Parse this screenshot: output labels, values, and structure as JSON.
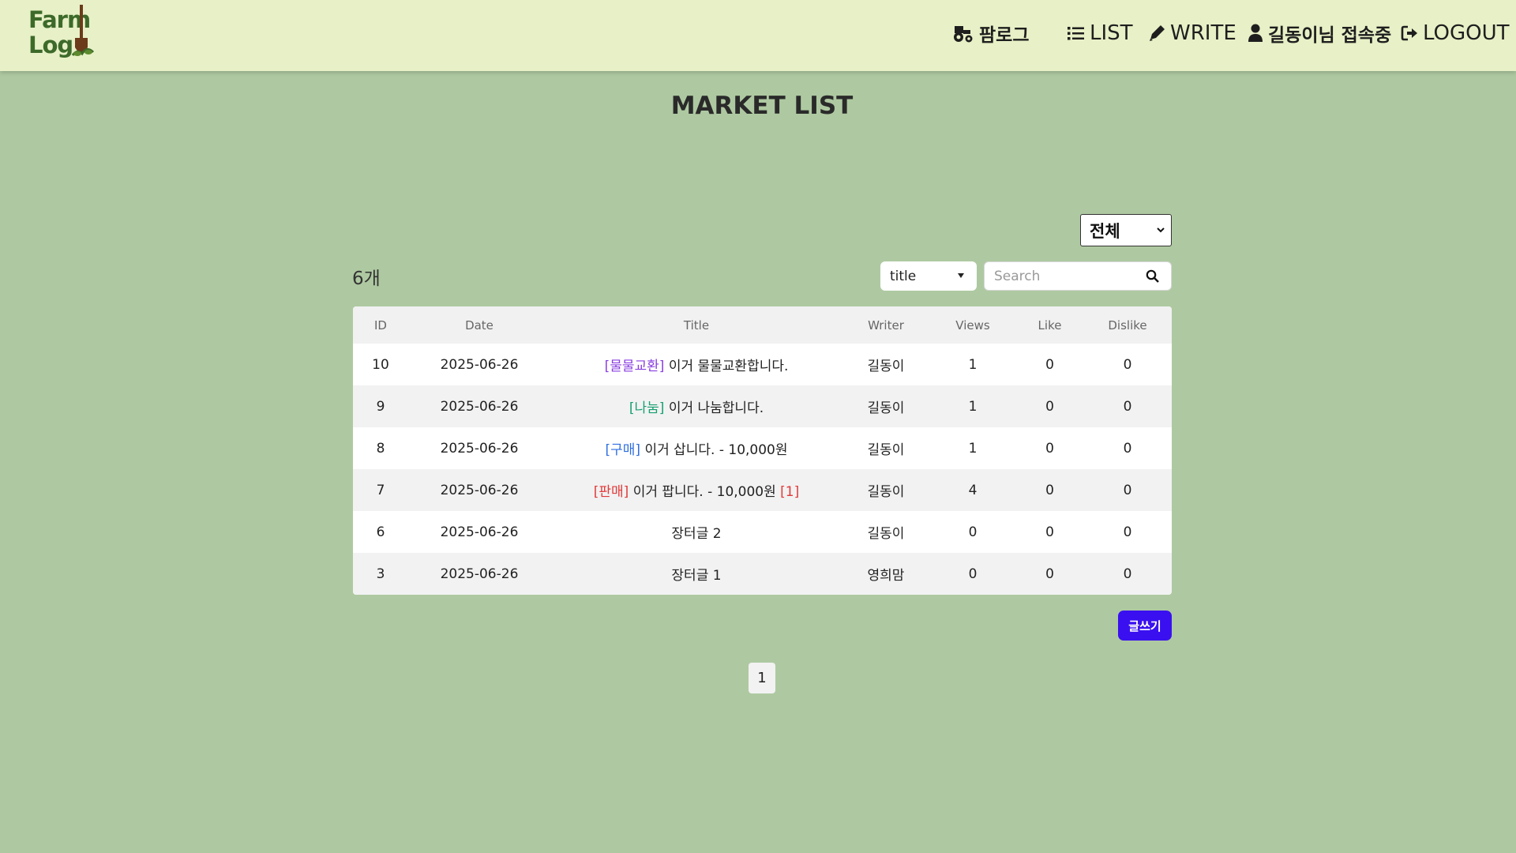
{
  "header": {
    "logo_line1": "Farm",
    "logo_line2": "Log",
    "nav": {
      "farmlog_label": "팜로그",
      "list_label": "LIST",
      "write_label": "WRITE",
      "user_label": "길동이님 접속중",
      "logout_label": "LOGOUT"
    }
  },
  "main": {
    "title": "MARKET LIST",
    "category_selected": "전체",
    "count_label": "6개",
    "search_type_selected": "title",
    "search_placeholder": "Search",
    "columns": [
      "ID",
      "Date",
      "Title",
      "Writer",
      "Views",
      "Like",
      "Dislike"
    ],
    "rows": [
      {
        "id": "10",
        "date": "2025-06-26",
        "tag": "[물물교환]",
        "tag_color": "#8a3fe0",
        "title": "이거 물물교환합니다.",
        "comments": "",
        "writer": "길동이",
        "views": "1",
        "like": "0",
        "dislike": "0"
      },
      {
        "id": "9",
        "date": "2025-06-26",
        "tag": "[나눔]",
        "tag_color": "#16a070",
        "title": "이거 나눔합니다.",
        "comments": "",
        "writer": "길동이",
        "views": "1",
        "like": "0",
        "dislike": "0"
      },
      {
        "id": "8",
        "date": "2025-06-26",
        "tag": "[구매]",
        "tag_color": "#2f6fe0",
        "title": "이거 삽니다. - 10,000원",
        "comments": "",
        "writer": "길동이",
        "views": "1",
        "like": "0",
        "dislike": "0"
      },
      {
        "id": "7",
        "date": "2025-06-26",
        "tag": "[판매]",
        "tag_color": "#e03a3a",
        "title": "이거 팝니다. - 10,000원",
        "comments": "[1]",
        "writer": "길동이",
        "views": "4",
        "like": "0",
        "dislike": "0"
      },
      {
        "id": "6",
        "date": "2025-06-26",
        "tag": "",
        "tag_color": "",
        "title": "장터글 2",
        "comments": "",
        "writer": "길동이",
        "views": "0",
        "like": "0",
        "dislike": "0"
      },
      {
        "id": "3",
        "date": "2025-06-26",
        "tag": "",
        "tag_color": "",
        "title": "장터글 1",
        "comments": "",
        "writer": "영희맘",
        "views": "0",
        "like": "0",
        "dislike": "0"
      }
    ],
    "write_button_label": "글쓰기",
    "pagination": [
      "1"
    ]
  },
  "colors": {
    "background": "#aec9a1",
    "header": "#e7f0c6",
    "write_button": "#3a10f0"
  }
}
